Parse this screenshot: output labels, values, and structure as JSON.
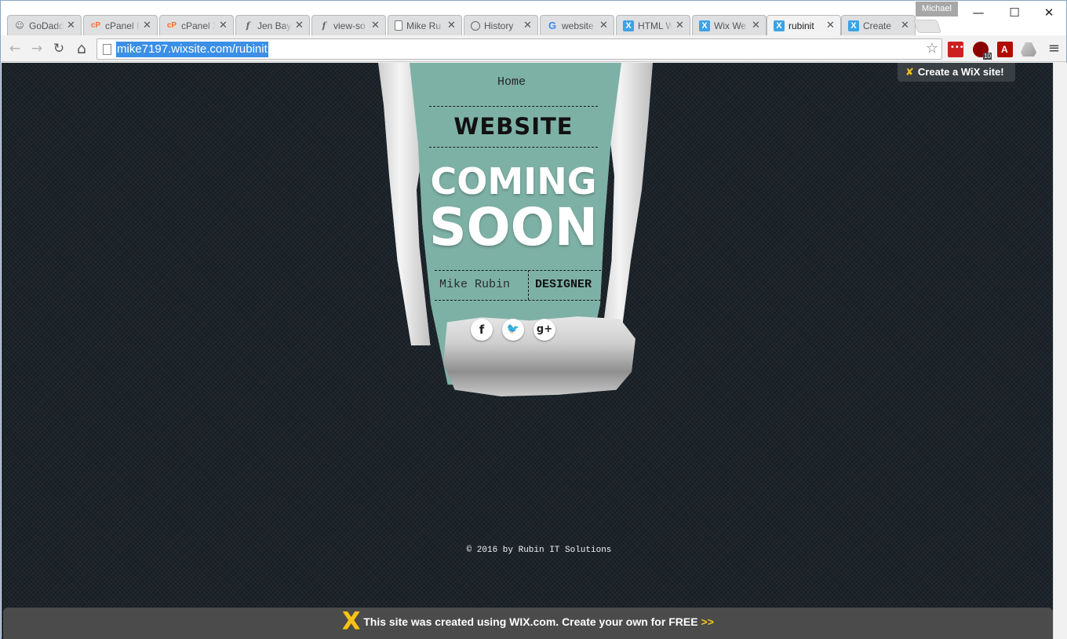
{
  "browser": {
    "profile_name": "Michael",
    "tabs": [
      {
        "title": "GoDaddy",
        "icon": "godaddy-icon",
        "glyph": "☺"
      },
      {
        "title": "cPanel F",
        "icon": "cpanel-icon",
        "glyph": "cP"
      },
      {
        "title": "cPanel X",
        "icon": "cpanel-icon",
        "glyph": "cP"
      },
      {
        "title": "Jen Bay",
        "icon": "feather-icon",
        "glyph": "f"
      },
      {
        "title": "view-so",
        "icon": "feather-icon",
        "glyph": "f"
      },
      {
        "title": "Mike Ru",
        "icon": "document-icon",
        "glyph": ""
      },
      {
        "title": "History",
        "icon": "history-icon",
        "glyph": ""
      },
      {
        "title": "website",
        "icon": "google-icon",
        "glyph": "G"
      },
      {
        "title": "HTML W",
        "icon": "wix-icon",
        "glyph": "X"
      },
      {
        "title": "Wix We",
        "icon": "wix-icon",
        "glyph": "X"
      },
      {
        "title": "rubinit",
        "icon": "wix-icon",
        "glyph": "X",
        "active": true
      },
      {
        "title": "Create",
        "icon": "wix-icon",
        "glyph": "X"
      }
    ],
    "close_glyph": "✕",
    "window_controls": {
      "minimize": "—",
      "maximize": "☐",
      "close": "✕"
    },
    "toolbar": {
      "back": "←",
      "forward": "→",
      "reload": "↻",
      "home": "⌂",
      "star": "☆",
      "menu": "≡"
    },
    "url": "mike7197.wixsite.com/rubinit"
  },
  "site": {
    "nav_home": "Home",
    "heading": "WEBSITE",
    "coming": "COMING",
    "soon": "SOON",
    "owner_name": "Mike Rubin",
    "owner_role": "DESIGNER",
    "social": {
      "facebook": "f",
      "twitter": "🐦",
      "googleplus": "g+"
    },
    "copyright": "© 2016 by Rubin IT Solutions",
    "create_badge": "Create a WiX site!",
    "banner_text": "This site was created using WIX.com. Create your own for FREE",
    "banner_arrows": ">>"
  },
  "colors": {
    "page_bg": "#1c242a",
    "teal": "#7eb1a6",
    "wix_yellow": "#f6c417",
    "url_highlight": "#3b8fe6"
  }
}
